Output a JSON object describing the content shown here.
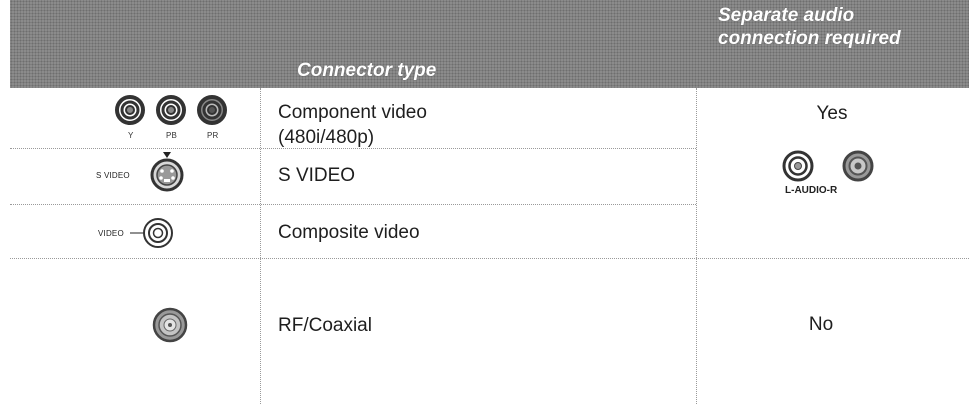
{
  "table": {
    "header": {
      "connector_type": "Connector type",
      "audio_line1": "Separate audio",
      "audio_line2": "connection required"
    },
    "rows": [
      {
        "connector_line1": "Component video",
        "connector_line2": "(480i/480p)",
        "icon": "component-video-jacks-icon",
        "icon_labels": [
          "Y",
          "PB",
          "PR"
        ]
      },
      {
        "connector": "S VIDEO",
        "icon": "s-video-jack-icon",
        "icon_label": "S VIDEO"
      },
      {
        "connector": "Composite video",
        "icon": "composite-video-jack-icon",
        "icon_label": "VIDEO"
      },
      {
        "connector": "RF/Coaxial",
        "icon": "rf-coaxial-jack-icon"
      }
    ],
    "audio_yes": "Yes",
    "audio_no": "No",
    "audio_icon": "l-r-audio-jacks-icon",
    "audio_icon_label": "L-AUDIO-R"
  }
}
